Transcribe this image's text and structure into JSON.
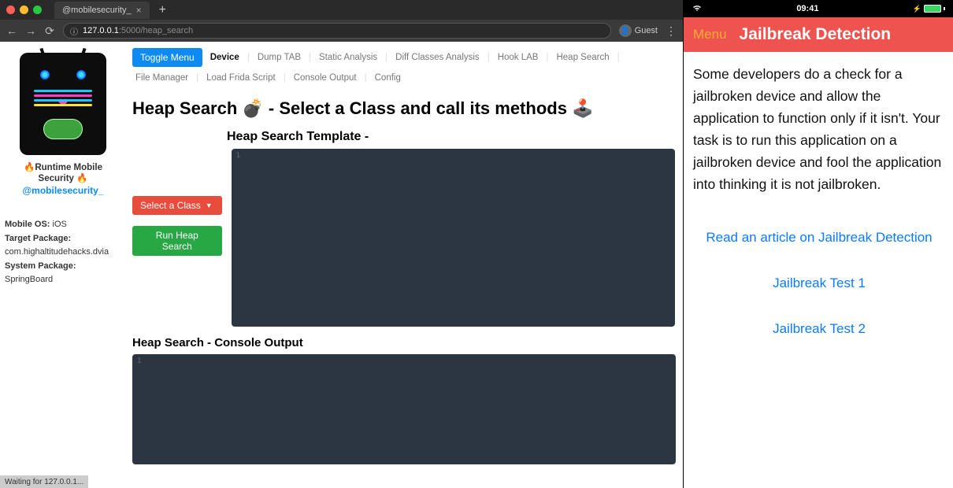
{
  "browser": {
    "tab_title": "@mobilesecurity_",
    "url_host": "127.0.0.1",
    "url_port": ":5000",
    "url_path": "/heap_search",
    "guest_label": "Guest",
    "status_text": "Waiting for 127.0.0.1..."
  },
  "sidebar": {
    "title": "🔥Runtime Mobile Security 🔥",
    "handle": "@mobilesecurity_",
    "os_label": "Mobile OS:",
    "os_value": "iOS",
    "target_label": "Target Package:",
    "target_value": "com.highaltitudehacks.dvia",
    "system_label": "System Package:",
    "system_value": "SpringBoard"
  },
  "nav": {
    "toggle": "Toggle Menu",
    "items": [
      "Device",
      "Dump TAB",
      "Static Analysis",
      "Diff Classes Analysis",
      "Hook LAB",
      "Heap Search",
      "File Manager",
      "Load Frida Script",
      "Console Output",
      "Config"
    ],
    "active_index": 0
  },
  "main": {
    "title": "Heap Search 💣 - Select a Class and call its methods 🕹️",
    "template_heading": "Heap Search Template -",
    "console_heading": "Heap Search - Console Output",
    "select_class": "Select a Class",
    "run": "Run Heap Search",
    "line1": "1",
    "line1b": "1"
  },
  "ios": {
    "time": "09:41",
    "menu": "Menu",
    "title": "Jailbreak Detection",
    "desc": "Some developers do a check for a jailbroken device and allow the application to function only if it isn't. Your task is to run this application on a jailbroken device and fool the application into thinking it is not jailbroken.",
    "link1": "Read an article on Jailbreak Detection",
    "link2": "Jailbreak Test 1",
    "link3": "Jailbreak Test 2"
  }
}
